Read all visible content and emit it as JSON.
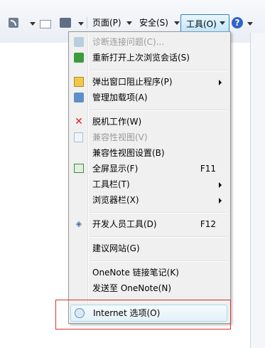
{
  "toolbar": {
    "page_label": "页面(P)",
    "safety_label": "安全(S)",
    "tools_label": "工具(O)",
    "help_icon": "?"
  },
  "menu": {
    "items": [
      {
        "label": "诊断连接问题(C)...",
        "shortcut": "",
        "disabled": true,
        "icon": "diagnose-icon"
      },
      {
        "label": "重新打开上次浏览会话(S)",
        "shortcut": "",
        "disabled": false,
        "icon": "reopen-session-icon"
      },
      {
        "label": "弹出窗口阻止程序(P)",
        "shortcut": "",
        "submenu": true,
        "icon": "popup-blocker-icon"
      },
      {
        "label": "管理加载项(A)",
        "shortcut": "",
        "icon": "manage-addons-icon"
      },
      {
        "label": "脱机工作(W)",
        "shortcut": "",
        "icon": "work-offline-icon"
      },
      {
        "label": "兼容性视图(V)",
        "shortcut": "",
        "disabled": true,
        "icon": "compat-view-icon"
      },
      {
        "label": "兼容性视图设置(B)",
        "shortcut": ""
      },
      {
        "label": "全屏显示(F)",
        "shortcut": "F11",
        "icon": "fullscreen-icon"
      },
      {
        "label": "工具栏(T)",
        "shortcut": "",
        "submenu": true
      },
      {
        "label": "浏览器栏(X)",
        "shortcut": "",
        "submenu": true
      },
      {
        "label": "开发人员工具(D)",
        "shortcut": "F12",
        "icon": "developer-tools-icon"
      },
      {
        "label": "建议网站(G)",
        "shortcut": ""
      },
      {
        "label": "OneNote 链接笔记(K)",
        "shortcut": ""
      },
      {
        "label": "发送至 OneNote(N)",
        "shortcut": ""
      },
      {
        "label": "Internet 选项(O)",
        "shortcut": "",
        "icon": "internet-options-icon",
        "highlighted": true
      }
    ]
  },
  "colors": {
    "highlight_border": "#a8d8eb",
    "annotation_box": "#d9342b",
    "disabled_text": "#9a9a9a"
  }
}
